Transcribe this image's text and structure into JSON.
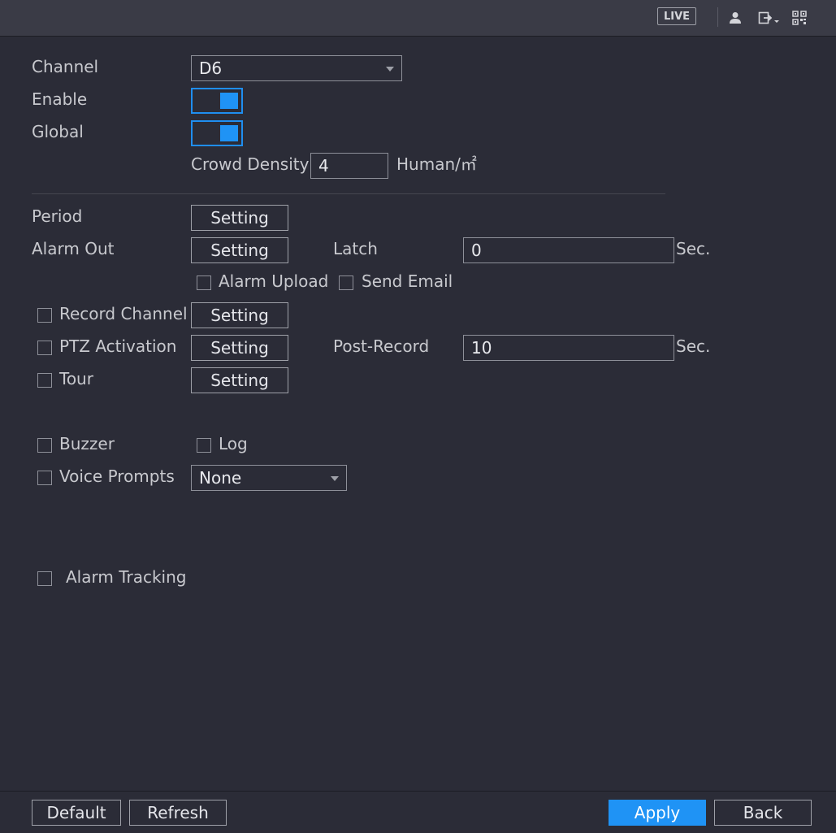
{
  "topbar": {
    "live_label": "LIVE",
    "icons": [
      "user-icon",
      "logout-icon",
      "qrcode-icon"
    ]
  },
  "form": {
    "channel": {
      "label": "Channel",
      "value": "D6"
    },
    "enable": {
      "label": "Enable",
      "on": true
    },
    "global": {
      "label": "Global",
      "on": true
    },
    "crowd_density": {
      "label": "Crowd Density",
      "value": "4",
      "unit": "Human/㎡"
    },
    "period": {
      "label": "Period",
      "button": "Setting"
    },
    "alarm_out": {
      "label": "Alarm Out",
      "button": "Setting"
    },
    "latch": {
      "label": "Latch",
      "value": "0",
      "unit": "Sec."
    },
    "alarm_upload": {
      "label": "Alarm Upload",
      "checked": false
    },
    "send_email": {
      "label": "Send Email",
      "checked": false
    },
    "record_channel": {
      "label": "Record Channel",
      "checked": false,
      "button": "Setting"
    },
    "ptz_activation": {
      "label": "PTZ Activation",
      "checked": false,
      "button": "Setting"
    },
    "post_record": {
      "label": "Post-Record",
      "value": "10",
      "unit": "Sec."
    },
    "tour": {
      "label": "Tour",
      "checked": false,
      "button": "Setting"
    },
    "buzzer": {
      "label": "Buzzer",
      "checked": false
    },
    "log": {
      "label": "Log",
      "checked": false
    },
    "voice_prompts": {
      "label": "Voice Prompts",
      "checked": false,
      "value": "None"
    },
    "alarm_tracking": {
      "label": "Alarm Tracking",
      "checked": false
    }
  },
  "footer": {
    "default": "Default",
    "refresh": "Refresh",
    "apply": "Apply",
    "back": "Back"
  },
  "colors": {
    "background": "#2b2c37",
    "accent": "#1f93f5",
    "topbar": "#3a3b46"
  }
}
